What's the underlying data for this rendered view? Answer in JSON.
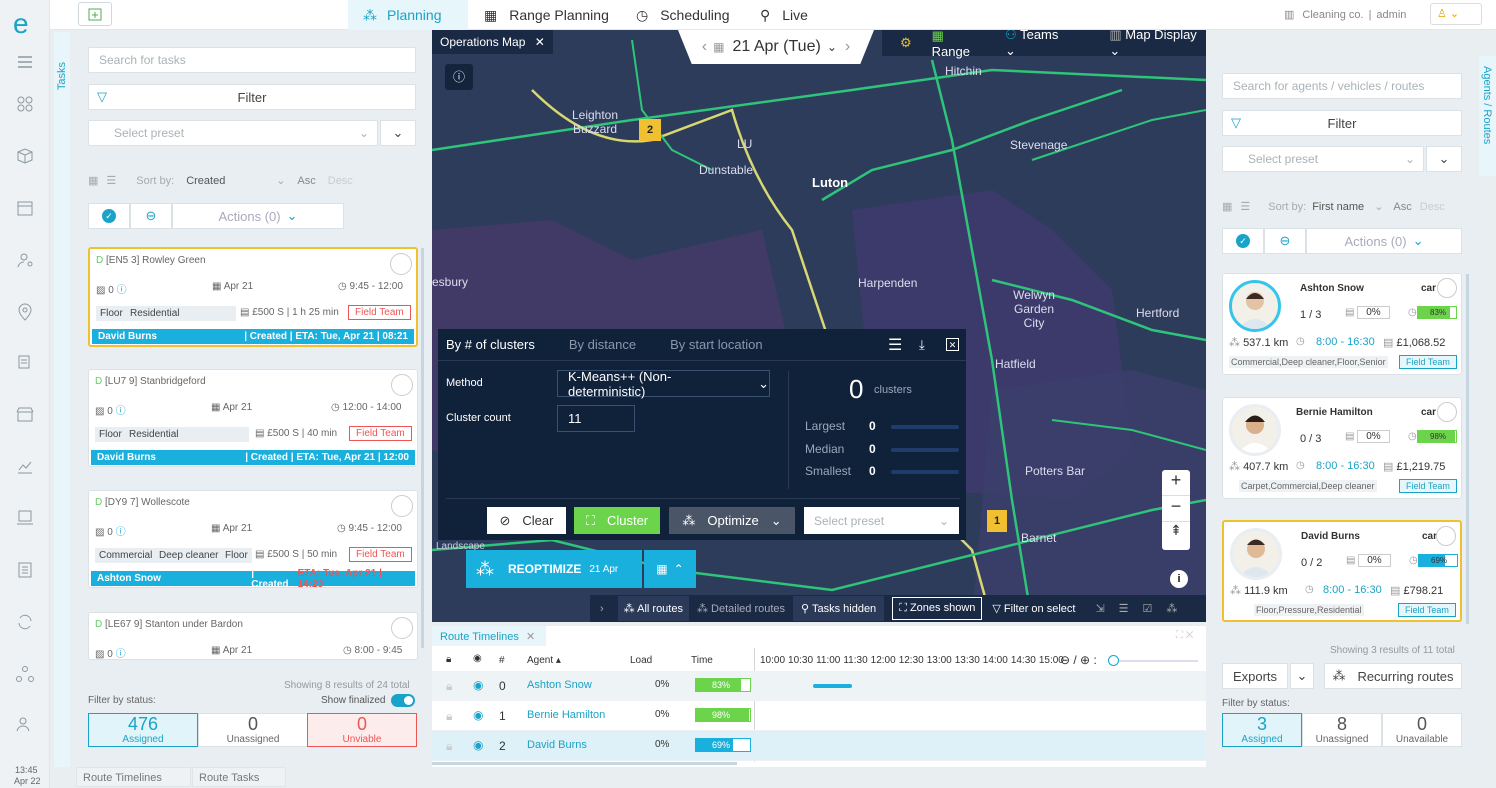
{
  "nav": {
    "tabs": [
      "Planning",
      "Range Planning",
      "Scheduling",
      "Live"
    ],
    "account": "Cleaning co.",
    "user": "admin",
    "time": "13:45",
    "date": "Apr 22"
  },
  "left": {
    "vtab": "Tasks",
    "search_placeholder": "Search for tasks",
    "filter": "Filter",
    "preset": "Select preset",
    "sort_by": "Sort by:",
    "sort_field": "Created",
    "asc": "Asc",
    "desc": "Desc",
    "actions": "Actions (0)",
    "tasks": [
      {
        "code": "D",
        "title": "[EN5 3] Rowley Green",
        "count": "0",
        "date": "Apr 21",
        "time": "9:45 - 12:00",
        "tags": [
          "Floor",
          "Residential"
        ],
        "price": "£500",
        "dur": "S | 1 h 25 min",
        "team": "Field Team",
        "agent": "David Burns",
        "status": "| Created | ETA: Tue, Apr 21 | 08:21"
      },
      {
        "code": "D",
        "title": "[LU7 9] Stanbridgeford",
        "count": "0",
        "date": "Apr 21",
        "time": "12:00 - 14:00",
        "tags": [
          "Floor",
          "Residential"
        ],
        "price": "£500",
        "dur": "S | 40 min",
        "team": "Field Team",
        "agent": "David Burns",
        "status": "| Created | ETA: Tue, Apr 21 | 12:00"
      },
      {
        "code": "D",
        "title": "[DY9 7] Wollescote",
        "count": "0",
        "date": "Apr 21",
        "time": "9:45 - 12:00",
        "tags": [
          "Commercial",
          "Deep cleaner",
          "Floor"
        ],
        "price": "£500",
        "dur": "S | 50 min",
        "team": "Field Team",
        "agent": "Ashton Snow",
        "status": "| Created",
        "status_red": "ETA: Tue, Apr 21 | 14:23"
      },
      {
        "code": "D",
        "title": "[LE67 9] Stanton under Bardon",
        "count": "0",
        "date": "Apr 21",
        "time": "8:00 - 9:45"
      }
    ],
    "showing": "Showing 8 results of 24 total",
    "filter_status": "Filter by status:",
    "show_finalized": "Show finalized",
    "stats": [
      {
        "n": "476",
        "l": "Assigned"
      },
      {
        "n": "0",
        "l": "Unassigned"
      },
      {
        "n": "0",
        "l": "Unviable"
      }
    ],
    "bottom_tabs": [
      "Route Timelines",
      "Route Tasks"
    ]
  },
  "map": {
    "tab": "Operations Map",
    "date": "21 Apr (Tue)",
    "range": "Range",
    "teams": "Teams",
    "display": "Map Display",
    "places": [
      "Hitchin",
      "Leighton Buzzard",
      "LU",
      "Dunstable",
      "Luton",
      "Stevenage",
      "Harpenden",
      "Welwyn Garden City",
      "Hertford",
      "Hatfield",
      "Potters Bar",
      "Barnet",
      "Landscape",
      "esbury"
    ],
    "markers": [
      "2",
      "1"
    ],
    "zoom_in": "+",
    "zoom_out": "−"
  },
  "cluster": {
    "tabs": [
      "By # of clusters",
      "By distance",
      "By start location"
    ],
    "method_label": "Method",
    "method": "K-Means++ (Non-deterministic)",
    "count_label": "Cluster count",
    "count": "11",
    "total": "0",
    "total_label": "clusters",
    "stats": [
      {
        "l": "Largest",
        "v": "0"
      },
      {
        "l": "Median",
        "v": "0"
      },
      {
        "l": "Smallest",
        "v": "0"
      }
    ],
    "clear": "Clear",
    "cluster": "Cluster",
    "optimize": "Optimize",
    "preset": "Select preset"
  },
  "reopt": {
    "label": "REOPTIMIZE",
    "date": "21 Apr"
  },
  "toolbar": {
    "all": "All routes",
    "detailed": "Detailed routes",
    "hidden": "Tasks hidden",
    "zones": "Zones shown",
    "filter": "Filter on select"
  },
  "timeline": {
    "tab": "Route Timelines",
    "cols": [
      "#",
      "Agent",
      "Load",
      "Time"
    ],
    "hours": [
      "10:00",
      "10:30",
      "11:00",
      "11:30",
      "12:00",
      "12:30",
      "13:00",
      "13:30",
      "14:00",
      "14:30",
      "15:00"
    ],
    "rows": [
      {
        "n": "0",
        "agent": "Ashton Snow",
        "load": "0%",
        "time": "83%",
        "pct": 0.83,
        "color": "#6cd44a"
      },
      {
        "n": "1",
        "agent": "Bernie Hamilton",
        "load": "0%",
        "time": "98%",
        "pct": 0.98,
        "color": "#6cd44a"
      },
      {
        "n": "2",
        "agent": "David Burns",
        "load": "0%",
        "time": "69%",
        "pct": 0.69,
        "color": "#1ab0de"
      }
    ]
  },
  "right": {
    "vtab": "Agents / Routes",
    "search_placeholder": "Search for agents / vehicles / routes",
    "filter": "Filter",
    "preset": "Select preset",
    "sort_by": "Sort by:",
    "sort_field": "First name",
    "asc": "Asc",
    "desc": "Desc",
    "actions": "Actions (0)",
    "agents": [
      {
        "name": "Ashton Snow",
        "veh": "car",
        "jobs": "1 / 3",
        "load": "0%",
        "time": "83%",
        "time_pct": 0.83,
        "km": "537.1 km",
        "hours": "8:00 - 16:30",
        "cost": "£1,068.52",
        "skills": "Commercial,Deep cleaner,Floor,Senior",
        "team": "Field Team"
      },
      {
        "name": "Bernie Hamilton",
        "veh": "car",
        "jobs": "0 / 3",
        "load": "0%",
        "time": "98%",
        "time_pct": 0.98,
        "km": "407.7 km",
        "hours": "8:00 - 16:30",
        "cost": "£1,219.75",
        "skills": "Carpet,Commercial,Deep cleaner",
        "team": "Field Team"
      },
      {
        "name": "David Burns",
        "veh": "car",
        "jobs": "0 / 2",
        "load": "0%",
        "time": "69%",
        "time_pct": 0.69,
        "km": "111.9 km",
        "hours": "8:00 - 16:30",
        "cost": "£798.21",
        "skills": "Floor,Pressure,Residential",
        "team": "Field Team"
      }
    ],
    "showing": "Showing 3 results of 11 total",
    "exports": "Exports",
    "recurring": "Recurring routes",
    "filter_status": "Filter by status:",
    "stats": [
      {
        "n": "3",
        "l": "Assigned"
      },
      {
        "n": "8",
        "l": "Unassigned"
      },
      {
        "n": "0",
        "l": "Unavailable"
      }
    ]
  }
}
